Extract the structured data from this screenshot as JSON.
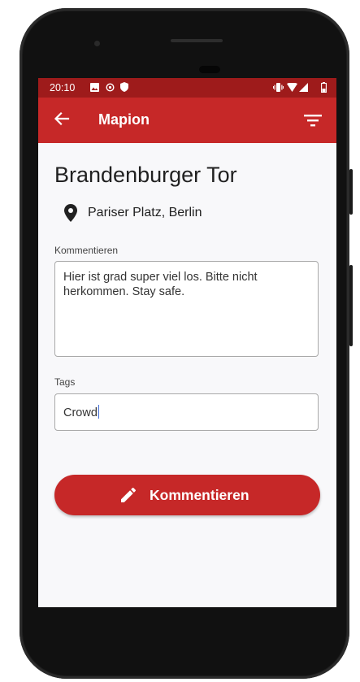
{
  "status_bar": {
    "time": "20:10",
    "left_icons": [
      "image-icon",
      "location-target-icon",
      "shield-icon"
    ],
    "right_icons": [
      "vibrate-icon",
      "wifi-icon",
      "signal-icon",
      "battery-icon"
    ]
  },
  "app_bar": {
    "title": "Mapion",
    "back_icon": "arrow-left-icon",
    "action_icon": "filter-icon"
  },
  "place": {
    "name": "Brandenburger Tor",
    "address": "Pariser Platz, Berlin",
    "address_icon": "location-pin-icon"
  },
  "form": {
    "comment_label": "Kommentieren",
    "comment_value": "Hier ist grad super viel los. Bitte nicht herkommen. Stay safe.",
    "tags_label": "Tags",
    "tags_value": "Crowd"
  },
  "submit_button": {
    "label": "Kommentieren",
    "icon": "pencil-icon"
  },
  "colors": {
    "primary": "#c62828",
    "status_bar": "#9e1b1b",
    "background": "#f8f8fa",
    "input_border": "#a9a9a9",
    "cursor": "#3f6bd8"
  }
}
